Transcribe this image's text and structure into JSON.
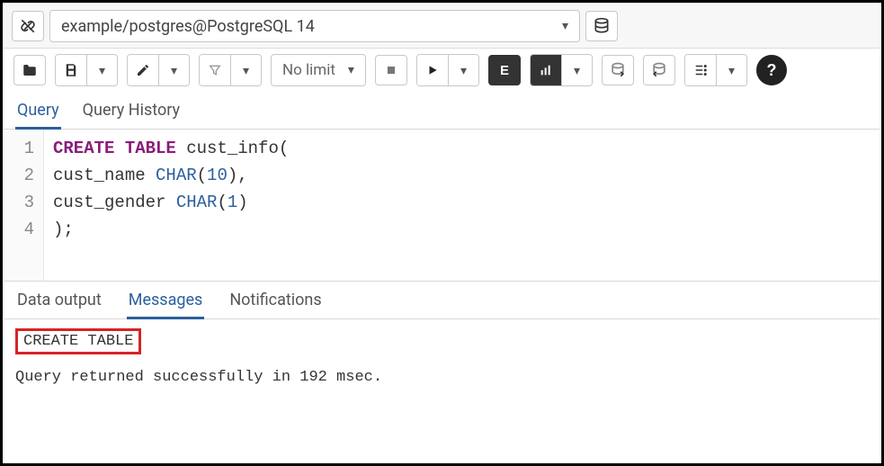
{
  "connection": {
    "label": "example/postgres@PostgreSQL 14"
  },
  "toolbar": {
    "limit_label": "No limit",
    "explain_label": "E"
  },
  "editor_tabs": {
    "query": "Query",
    "history": "Query History"
  },
  "editor": {
    "lines": [
      "1",
      "2",
      "3",
      "4"
    ],
    "code": {
      "l1_kw": "CREATE TABLE",
      "l1_rest": " cust_info(",
      "l2_a": "cust_name ",
      "l2_type": "CHAR",
      "l2_open": "(",
      "l2_num": "10",
      "l2_close": "),",
      "l3_a": "cust_gender ",
      "l3_type": "CHAR",
      "l3_open": "(",
      "l3_num": "1",
      "l3_close": ")",
      "l4": ");"
    }
  },
  "output_tabs": {
    "data": "Data output",
    "messages": "Messages",
    "notifications": "Notifications"
  },
  "messages": {
    "result": "CREATE TABLE",
    "status": "Query returned successfully in 192 msec."
  }
}
